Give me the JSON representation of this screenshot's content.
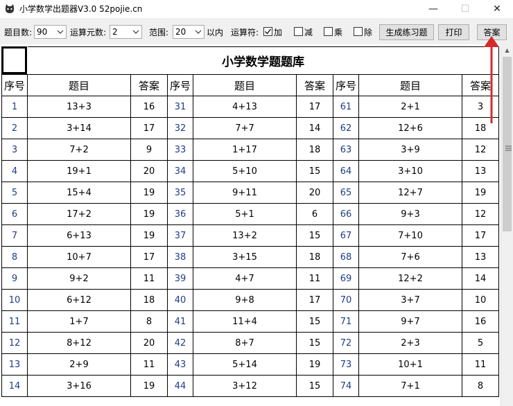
{
  "window": {
    "title": "小学数学出题器V3.0 52pojie.cn",
    "minimize": "—",
    "maximize": "☐",
    "close": "✕"
  },
  "toolbar": {
    "count_label": "题目数:",
    "count_value": "90",
    "operands_label": "运算元数:",
    "operands_value": "2",
    "range_label": "范围:",
    "range_value": "20",
    "range_suffix": "以内",
    "operator_label": "运算符:",
    "ops": [
      {
        "label": "加",
        "checked": true
      },
      {
        "label": "减",
        "checked": false
      },
      {
        "label": "乘",
        "checked": false
      },
      {
        "label": "除",
        "checked": false
      }
    ],
    "generate_button": "生成练习题",
    "print_button": "打印",
    "answer_button": "答案"
  },
  "sheet": {
    "title": "小学数学题题库",
    "headers": [
      "序号",
      "题目",
      "答案"
    ],
    "rows": [
      [
        [
          "1",
          "13+3",
          "16"
        ],
        [
          "31",
          "4+13",
          "17"
        ],
        [
          "61",
          "2+1",
          "3"
        ]
      ],
      [
        [
          "2",
          "3+14",
          "17"
        ],
        [
          "32",
          "7+7",
          "14"
        ],
        [
          "62",
          "12+6",
          "18"
        ]
      ],
      [
        [
          "3",
          "7+2",
          "9"
        ],
        [
          "33",
          "1+17",
          "18"
        ],
        [
          "63",
          "3+9",
          "12"
        ]
      ],
      [
        [
          "4",
          "19+1",
          "20"
        ],
        [
          "34",
          "5+10",
          "15"
        ],
        [
          "64",
          "3+10",
          "13"
        ]
      ],
      [
        [
          "5",
          "15+4",
          "19"
        ],
        [
          "35",
          "9+11",
          "20"
        ],
        [
          "65",
          "12+7",
          "19"
        ]
      ],
      [
        [
          "6",
          "17+2",
          "19"
        ],
        [
          "36",
          "5+1",
          "6"
        ],
        [
          "66",
          "9+3",
          "12"
        ]
      ],
      [
        [
          "7",
          "6+13",
          "19"
        ],
        [
          "37",
          "13+2",
          "15"
        ],
        [
          "67",
          "7+10",
          "17"
        ]
      ],
      [
        [
          "8",
          "10+7",
          "17"
        ],
        [
          "38",
          "3+15",
          "18"
        ],
        [
          "68",
          "7+6",
          "13"
        ]
      ],
      [
        [
          "9",
          "9+2",
          "11"
        ],
        [
          "39",
          "4+7",
          "11"
        ],
        [
          "69",
          "12+2",
          "14"
        ]
      ],
      [
        [
          "10",
          "6+12",
          "18"
        ],
        [
          "40",
          "9+8",
          "17"
        ],
        [
          "70",
          "3+7",
          "10"
        ]
      ],
      [
        [
          "11",
          "1+7",
          "8"
        ],
        [
          "41",
          "11+4",
          "15"
        ],
        [
          "71",
          "9+7",
          "16"
        ]
      ],
      [
        [
          "12",
          "8+12",
          "20"
        ],
        [
          "42",
          "8+7",
          "15"
        ],
        [
          "72",
          "2+3",
          "5"
        ]
      ],
      [
        [
          "13",
          "2+9",
          "11"
        ],
        [
          "43",
          "5+14",
          "19"
        ],
        [
          "73",
          "10+1",
          "11"
        ]
      ],
      [
        [
          "14",
          "3+16",
          "19"
        ],
        [
          "44",
          "3+12",
          "15"
        ],
        [
          "74",
          "7+1",
          "8"
        ]
      ]
    ]
  },
  "colors": {
    "seq_text": "#1f3c88",
    "toolbar_bg": "#f0f0f0",
    "annotation_arrow": "#d42b2b"
  }
}
